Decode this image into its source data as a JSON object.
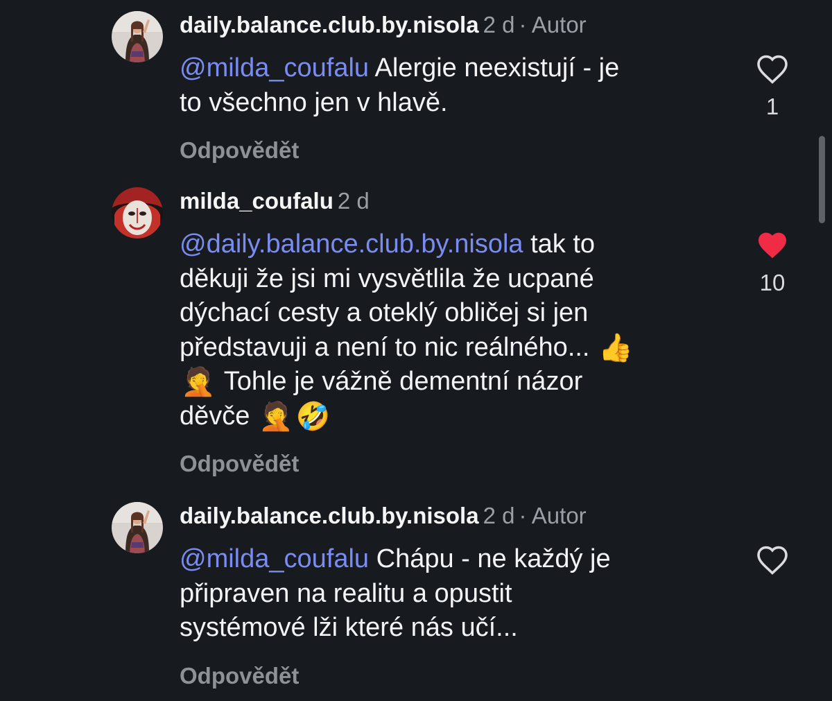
{
  "comments": [
    {
      "username": "daily.balance.club.by.nisola",
      "time": "2 d",
      "badge": "· Autor",
      "mention": "@milda_coufalu",
      "text_line1": " Alergie neexistují - je",
      "text_line2": "to všechno jen v hlavě.",
      "reply_label": "Odpovědět",
      "like_count": "1",
      "liked": false
    },
    {
      "username": "milda_coufalu",
      "time": "2 d",
      "mention": "@daily.balance.club.by.nisola",
      "text_line1": " tak to",
      "text_line2": "děkuji že jsi mi vysvětlila že ucpané",
      "text_line3": "dýchací cesty a oteklý obličej si jen",
      "text_line4": "představuji a není to nic reálného...",
      "text_line5": "Tohle je vážně dementní názor",
      "text_line6": "děvče",
      "emoji_thumbs": "👍",
      "emoji_facepalm": "🤦",
      "emoji_rofl": "🤣",
      "reply_label": "Odpovědět",
      "like_count": "10",
      "liked": true
    },
    {
      "username": "daily.balance.club.by.nisola",
      "time": "2 d",
      "badge": "· Autor",
      "mention": "@milda_coufalu",
      "text_line1": " Chápu - ne každý je",
      "text_line2": "připraven na realitu a opustit",
      "text_line3": "systémové lži které nás učí...",
      "reply_label": "Odpovědět",
      "like_count": "",
      "liked": false
    }
  ],
  "icons": {
    "like": "heart-outline-icon",
    "liked": "heart-filled-icon"
  },
  "colors": {
    "background": "#171a1f",
    "mention": "#7b8cf0",
    "muted": "#9aa0a6",
    "liked_heart": "#ef2b45"
  }
}
